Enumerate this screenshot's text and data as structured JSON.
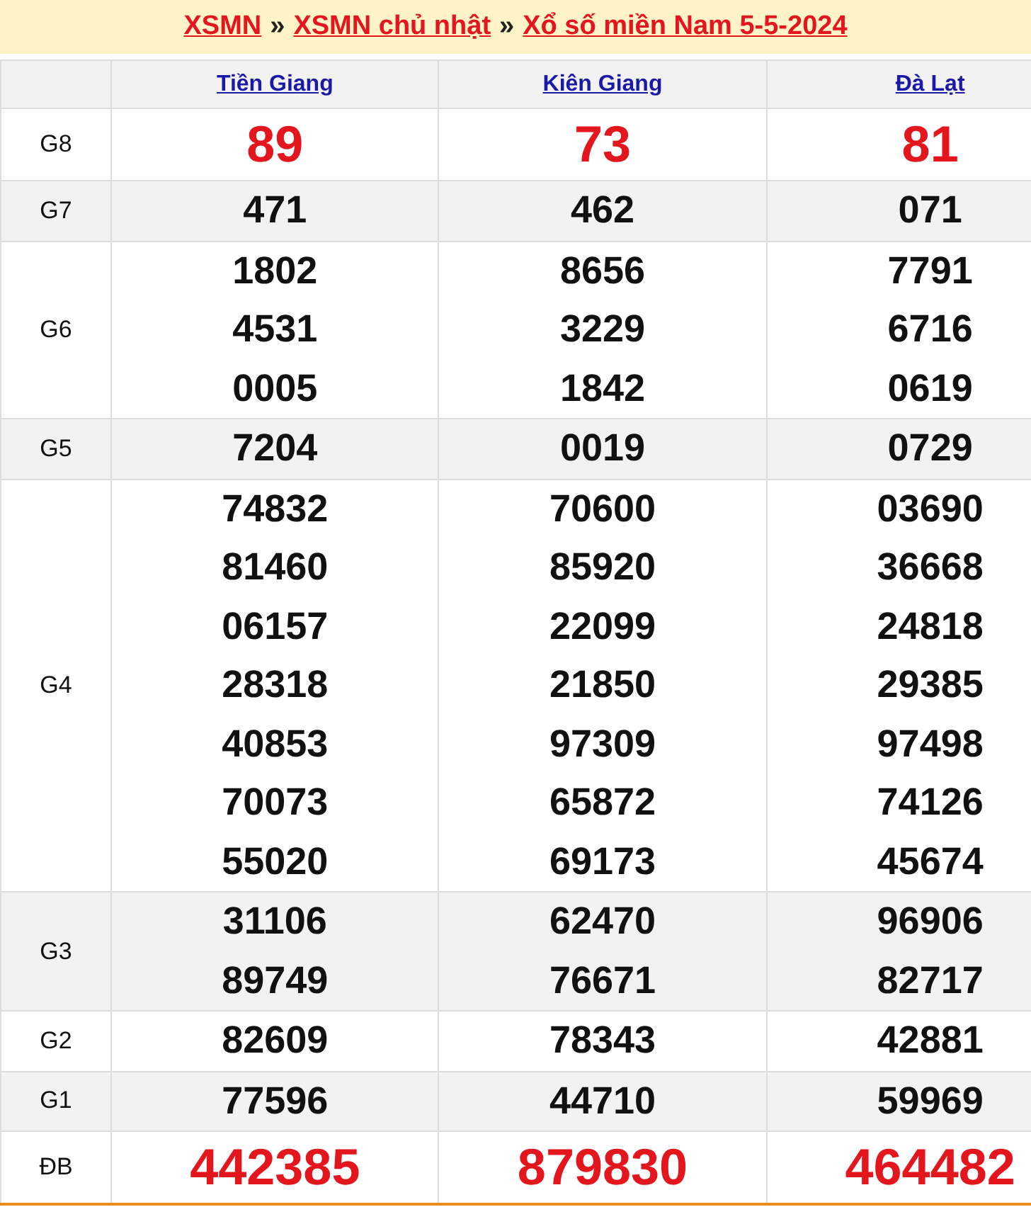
{
  "breadcrumb": [
    {
      "kind": "link",
      "text": "XSMN"
    },
    {
      "kind": "separator",
      "text": "»"
    },
    {
      "kind": "link",
      "text": "XSMN chủ nhật"
    },
    {
      "kind": "separator",
      "text": "»"
    },
    {
      "kind": "link",
      "text": "Xổ số miền Nam 5-5-2024"
    }
  ],
  "table": {
    "columns": [
      "Tiền Giang",
      "Kiên Giang",
      "Đà Lạt"
    ],
    "rows": [
      {
        "label": "G8",
        "kind": "special",
        "cells": [
          [
            "89"
          ],
          [
            "73"
          ],
          [
            "81"
          ]
        ]
      },
      {
        "label": "G7",
        "kind": "normal",
        "cells": [
          [
            "471"
          ],
          [
            "462"
          ],
          [
            "071"
          ]
        ]
      },
      {
        "label": "G6",
        "kind": "normal",
        "cells": [
          [
            "1802",
            "4531",
            "0005"
          ],
          [
            "8656",
            "3229",
            "1842"
          ],
          [
            "7791",
            "6716",
            "0619"
          ]
        ]
      },
      {
        "label": "G5",
        "kind": "normal",
        "cells": [
          [
            "7204"
          ],
          [
            "0019"
          ],
          [
            "0729"
          ]
        ]
      },
      {
        "label": "G4",
        "kind": "normal",
        "cells": [
          [
            "74832",
            "81460",
            "06157",
            "28318",
            "40853",
            "70073",
            "55020"
          ],
          [
            "70600",
            "85920",
            "22099",
            "21850",
            "97309",
            "65872",
            "69173"
          ],
          [
            "03690",
            "36668",
            "24818",
            "29385",
            "97498",
            "74126",
            "45674"
          ]
        ]
      },
      {
        "label": "G3",
        "kind": "normal",
        "cells": [
          [
            "31106",
            "89749"
          ],
          [
            "62470",
            "76671"
          ],
          [
            "96906",
            "82717"
          ]
        ]
      },
      {
        "label": "G2",
        "kind": "normal",
        "cells": [
          [
            "82609"
          ],
          [
            "78343"
          ],
          [
            "42881"
          ]
        ]
      },
      {
        "label": "G1",
        "kind": "normal",
        "cells": [
          [
            "77596"
          ],
          [
            "44710"
          ],
          [
            "59969"
          ]
        ]
      },
      {
        "label": "ĐB",
        "kind": "special",
        "cells": [
          [
            "442385"
          ],
          [
            "879830"
          ],
          [
            "464482"
          ]
        ]
      }
    ]
  }
}
